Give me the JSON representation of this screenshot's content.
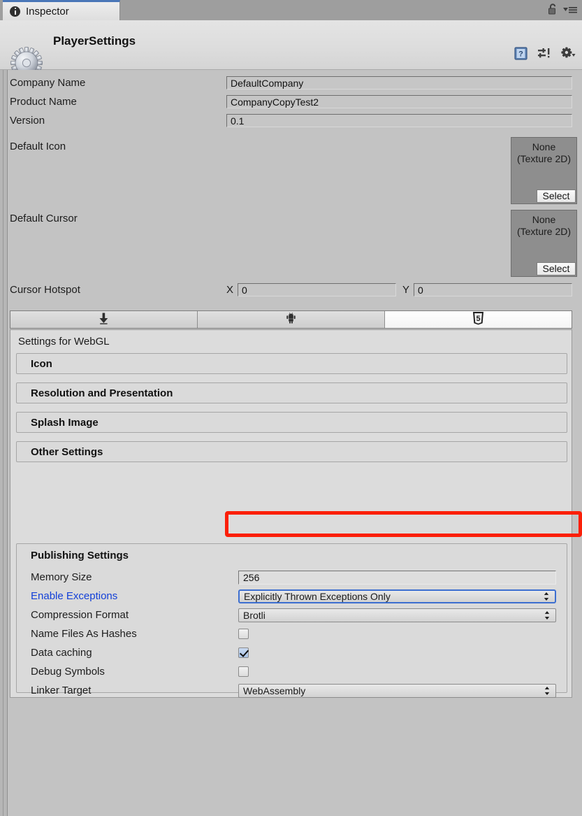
{
  "window": {
    "tab_label": "Inspector",
    "tab_icon": "info-icon",
    "lock_icon": "lock-icon",
    "menu_icon": "hamburger-menu-icon"
  },
  "object_header": {
    "title": "PlayerSettings",
    "icon": "gear-icon",
    "help_icon": "help-book-icon",
    "preset_icon": "preset-sliders-icon",
    "settings_icon": "gear-dropdown-icon"
  },
  "general": {
    "fields": [
      {
        "label": "Company Name",
        "value": "DefaultCompany",
        "name": "company-name"
      },
      {
        "label": "Product Name",
        "value": "CompanyCopyTest2",
        "name": "product-name"
      },
      {
        "label": "Version",
        "value": "0.1",
        "name": "version"
      }
    ],
    "default_icon": {
      "label": "Default Icon",
      "value": "None\n(Texture 2D)",
      "select_label": "Select"
    },
    "default_cursor": {
      "label": "Default Cursor",
      "value": "None\n(Texture 2D)",
      "select_label": "Select"
    },
    "cursor_hotspot": {
      "label": "Cursor Hotspot",
      "x_label": "X",
      "x_value": "0",
      "y_label": "Y",
      "y_value": "0"
    }
  },
  "platform_tabs": [
    {
      "name": "standalone",
      "icon": "download-arrow-icon",
      "active": false
    },
    {
      "name": "android",
      "icon": "android-robot-icon",
      "active": false
    },
    {
      "name": "webgl",
      "icon": "html5-shield-icon",
      "active": true
    }
  ],
  "settings": {
    "title": "Settings for WebGL",
    "sections": [
      {
        "label": "Icon",
        "name": "icon"
      },
      {
        "label": "Resolution and Presentation",
        "name": "resolution-and-presentation"
      },
      {
        "label": "Splash Image",
        "name": "splash-image"
      },
      {
        "label": "Other Settings",
        "name": "other-settings"
      }
    ]
  },
  "publishing": {
    "title": "Publishing Settings",
    "memory_size": {
      "label": "Memory Size",
      "value": "256"
    },
    "enable_exceptions": {
      "label": "Enable Exceptions",
      "value": "Explicitly Thrown Exceptions Only",
      "modified": true,
      "focused": true,
      "highlighted": true
    },
    "compression_format": {
      "label": "Compression Format",
      "value": "Brotli"
    },
    "name_files_as_hashes": {
      "label": "Name Files As Hashes",
      "checked": false
    },
    "data_caching": {
      "label": "Data caching",
      "checked": true
    },
    "debug_symbols": {
      "label": "Debug Symbols",
      "checked": false
    },
    "linker_target": {
      "label": "Linker Target",
      "value": "WebAssembly"
    }
  },
  "colors": {
    "window_bg": "#9e9e9e",
    "panel_bg": "#c3c3c3",
    "section_bg": "#dcdcdc",
    "tab_accent": "#4a77b8",
    "modified_label": "#1340d8",
    "focus_border": "#3d6fd0",
    "annotation": "#fb1f07"
  }
}
